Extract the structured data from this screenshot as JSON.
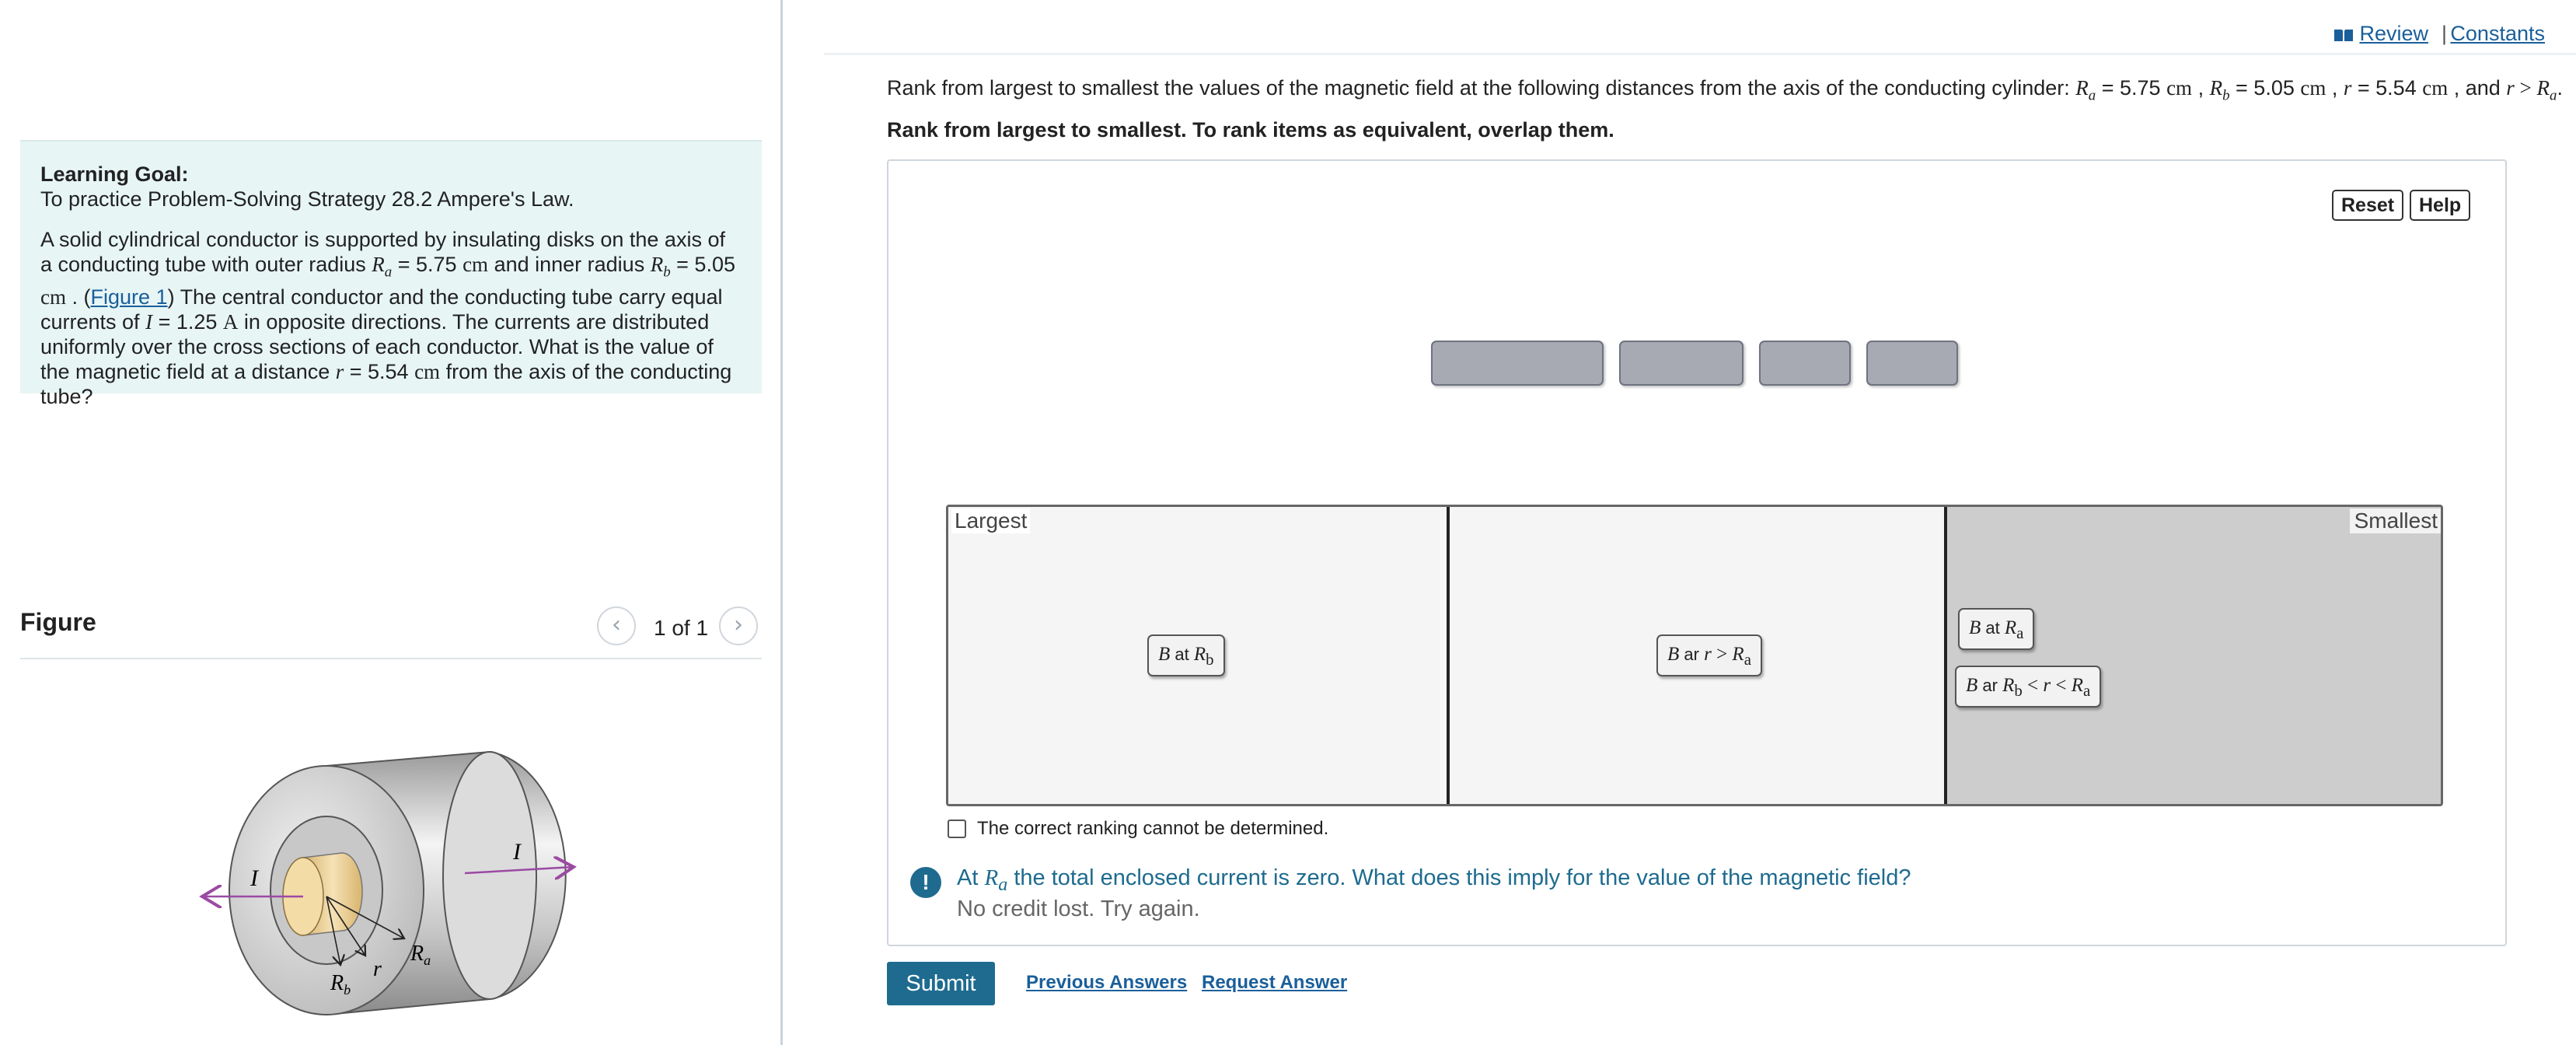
{
  "learning_goal": {
    "title": "Learning Goal:",
    "subtitle": "To practice Problem-Solving Strategy 28.2 Ampere's Law.",
    "p1": "A solid cylindrical conductor is supported by insulating disks on the axis of a conducting tube with outer radius",
    "Ra_sym": "R",
    "Ra_sub": "a",
    "Ra_val": " = 5.75 ",
    "unit_cm": "cm",
    "p2": " and inner radius ",
    "Rb_sym": "R",
    "Rb_sub": "b",
    "Rb_val": " = 5.05",
    "p3": " . (",
    "figure_link": "Figure 1",
    "p4": ") The central conductor and the conducting tube carry equal currents of ",
    "I_sym": "I",
    "I_val": " = 1.25 ",
    "unit_A": "A",
    "p5": " in opposite directions. The currents are distributed uniformly over the cross sections of each conductor. What is the value of the magnetic field at a distance ",
    "r_sym": "r",
    "r_val": " = 5.54 ",
    "p6": " from the axis of the conducting tube?"
  },
  "figure": {
    "title": "Figure",
    "counter": "1 of 1",
    "labels": {
      "I_left": "I",
      "I_right": "I",
      "Ra": "R",
      "Ra_sub": "a",
      "Rb": "R",
      "Rb_sub": "b",
      "r": "r"
    },
    "colors": {
      "arrow": "#9b4aa3",
      "inner": "#e8c98f",
      "tube": "#bfbfbf"
    }
  },
  "topbar": {
    "review": "Review",
    "separator": "|",
    "constants": "Constants",
    "review_icon": "book-icon"
  },
  "question": {
    "text": "Rank from largest to smallest the values of the magnetic field at the following distances from the axis of the conducting cylinder: ",
    "Ra": "R",
    "Ra_sub": "a",
    "Ra_val": " = 5.75 ",
    "unit": "cm",
    "comma": " , ",
    "Rb": "R",
    "Rb_sub": "b",
    "Rb_val": " = 5.05 ",
    "r": "r",
    "r_val": " = 5.54 ",
    "and": " , and ",
    "gt": " > ",
    "end": "."
  },
  "instruction": "Rank from largest to smallest. To rank items as equivalent, overlap them.",
  "panel": {
    "reset": "Reset",
    "help": "Help",
    "largest": "Largest",
    "smallest": "Smallest",
    "zones": [
      {
        "chips": [
          {
            "id": "b-rb",
            "B": "B",
            "at": " at ",
            "R": "R",
            "sub": "b"
          }
        ]
      },
      {
        "chips": [
          {
            "id": "b-rgt",
            "B": "B",
            "ar": " ar ",
            "r": "r",
            "gt": " > ",
            "R": "R",
            "sub": "a"
          }
        ]
      },
      {
        "chips": [
          {
            "id": "b-ra",
            "B": "B",
            "at": " at ",
            "R": "R",
            "sub": "a"
          },
          {
            "id": "b-between",
            "B": "B",
            "ar": " ar ",
            "R1": "R",
            "sub1": "b",
            "lt1": " < ",
            "r": "r",
            "lt2": " < ",
            "R2": "R",
            "sub2": "a"
          }
        ]
      }
    ],
    "cannot_determine": "The correct ranking cannot be determined.",
    "cannot_checked": false
  },
  "feedback": {
    "icon": "!",
    "hint_pre": "At ",
    "hint_R": "R",
    "hint_sub": "a",
    "hint_post": " the total enclosed current is zero. What does this imply for the value of the magnetic field?",
    "credit": "No credit lost. Try again."
  },
  "actions": {
    "submit": "Submit",
    "previous_answers": "Previous Answers",
    "request_answer": "Request Answer"
  }
}
